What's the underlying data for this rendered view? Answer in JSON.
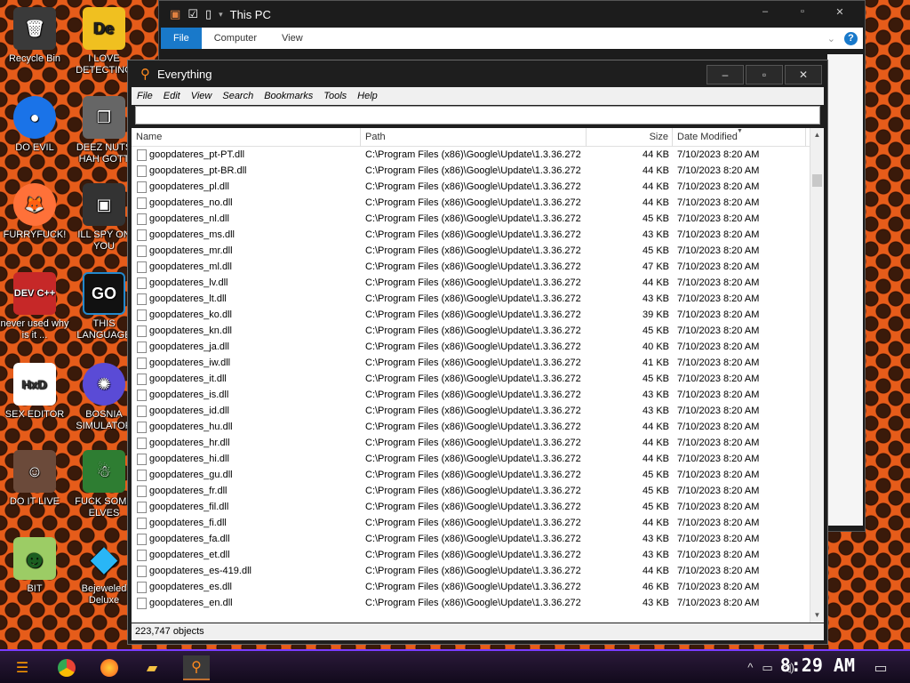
{
  "desktop": {
    "icons": [
      {
        "label": "Recycle Bin",
        "glyph": "🗑"
      },
      {
        "label": "I LOVE DETECTING",
        "glyph": "De"
      },
      {
        "label": "DO EVIL",
        "glyph": "●"
      },
      {
        "label": "DEEZ NUTS HAH GOTT",
        "glyph": "❐"
      },
      {
        "label": "FURRYFUCK!",
        "glyph": "🦊"
      },
      {
        "label": "ILL SPY ON YOU",
        "glyph": "▣"
      },
      {
        "label": "never used why is it ...",
        "glyph": "DEV C++"
      },
      {
        "label": "THIS LANGUAGE",
        "glyph": "GO"
      },
      {
        "label": "SEX EDITOR",
        "glyph": "HxD"
      },
      {
        "label": "BOSNIA SIMULATOR",
        "glyph": "✺"
      },
      {
        "label": "DO IT LIVE",
        "glyph": "☺"
      },
      {
        "label": "FUCK SOME ELVES",
        "glyph": "☃"
      },
      {
        "label": "BIT",
        "glyph": "☻"
      },
      {
        "label": "Bejeweled Deluxe",
        "glyph": "◆"
      }
    ]
  },
  "explorer": {
    "title": "This PC",
    "tabs": [
      "File",
      "Computer",
      "View"
    ],
    "help_icon": "?"
  },
  "everything": {
    "title": "Everything",
    "menu": [
      "File",
      "Edit",
      "View",
      "Search",
      "Bookmarks",
      "Tools",
      "Help"
    ],
    "search_value": "",
    "columns": {
      "name": "Name",
      "path": "Path",
      "size": "Size",
      "date": "Date Modified"
    },
    "rows": [
      {
        "name": "goopdateres_pt-PT.dll",
        "path": "C:\\Program Files (x86)\\Google\\Update\\1.3.36.272",
        "size": "44 KB",
        "date": "7/10/2023 8:20 AM"
      },
      {
        "name": "goopdateres_pt-BR.dll",
        "path": "C:\\Program Files (x86)\\Google\\Update\\1.3.36.272",
        "size": "44 KB",
        "date": "7/10/2023 8:20 AM"
      },
      {
        "name": "goopdateres_pl.dll",
        "path": "C:\\Program Files (x86)\\Google\\Update\\1.3.36.272",
        "size": "44 KB",
        "date": "7/10/2023 8:20 AM"
      },
      {
        "name": "goopdateres_no.dll",
        "path": "C:\\Program Files (x86)\\Google\\Update\\1.3.36.272",
        "size": "44 KB",
        "date": "7/10/2023 8:20 AM"
      },
      {
        "name": "goopdateres_nl.dll",
        "path": "C:\\Program Files (x86)\\Google\\Update\\1.3.36.272",
        "size": "45 KB",
        "date": "7/10/2023 8:20 AM"
      },
      {
        "name": "goopdateres_ms.dll",
        "path": "C:\\Program Files (x86)\\Google\\Update\\1.3.36.272",
        "size": "43 KB",
        "date": "7/10/2023 8:20 AM"
      },
      {
        "name": "goopdateres_mr.dll",
        "path": "C:\\Program Files (x86)\\Google\\Update\\1.3.36.272",
        "size": "45 KB",
        "date": "7/10/2023 8:20 AM"
      },
      {
        "name": "goopdateres_ml.dll",
        "path": "C:\\Program Files (x86)\\Google\\Update\\1.3.36.272",
        "size": "47 KB",
        "date": "7/10/2023 8:20 AM"
      },
      {
        "name": "goopdateres_lv.dll",
        "path": "C:\\Program Files (x86)\\Google\\Update\\1.3.36.272",
        "size": "44 KB",
        "date": "7/10/2023 8:20 AM"
      },
      {
        "name": "goopdateres_lt.dll",
        "path": "C:\\Program Files (x86)\\Google\\Update\\1.3.36.272",
        "size": "43 KB",
        "date": "7/10/2023 8:20 AM"
      },
      {
        "name": "goopdateres_ko.dll",
        "path": "C:\\Program Files (x86)\\Google\\Update\\1.3.36.272",
        "size": "39 KB",
        "date": "7/10/2023 8:20 AM"
      },
      {
        "name": "goopdateres_kn.dll",
        "path": "C:\\Program Files (x86)\\Google\\Update\\1.3.36.272",
        "size": "45 KB",
        "date": "7/10/2023 8:20 AM"
      },
      {
        "name": "goopdateres_ja.dll",
        "path": "C:\\Program Files (x86)\\Google\\Update\\1.3.36.272",
        "size": "40 KB",
        "date": "7/10/2023 8:20 AM"
      },
      {
        "name": "goopdateres_iw.dll",
        "path": "C:\\Program Files (x86)\\Google\\Update\\1.3.36.272",
        "size": "41 KB",
        "date": "7/10/2023 8:20 AM"
      },
      {
        "name": "goopdateres_it.dll",
        "path": "C:\\Program Files (x86)\\Google\\Update\\1.3.36.272",
        "size": "45 KB",
        "date": "7/10/2023 8:20 AM"
      },
      {
        "name": "goopdateres_is.dll",
        "path": "C:\\Program Files (x86)\\Google\\Update\\1.3.36.272",
        "size": "43 KB",
        "date": "7/10/2023 8:20 AM"
      },
      {
        "name": "goopdateres_id.dll",
        "path": "C:\\Program Files (x86)\\Google\\Update\\1.3.36.272",
        "size": "43 KB",
        "date": "7/10/2023 8:20 AM"
      },
      {
        "name": "goopdateres_hu.dll",
        "path": "C:\\Program Files (x86)\\Google\\Update\\1.3.36.272",
        "size": "44 KB",
        "date": "7/10/2023 8:20 AM"
      },
      {
        "name": "goopdateres_hr.dll",
        "path": "C:\\Program Files (x86)\\Google\\Update\\1.3.36.272",
        "size": "44 KB",
        "date": "7/10/2023 8:20 AM"
      },
      {
        "name": "goopdateres_hi.dll",
        "path": "C:\\Program Files (x86)\\Google\\Update\\1.3.36.272",
        "size": "44 KB",
        "date": "7/10/2023 8:20 AM"
      },
      {
        "name": "goopdateres_gu.dll",
        "path": "C:\\Program Files (x86)\\Google\\Update\\1.3.36.272",
        "size": "45 KB",
        "date": "7/10/2023 8:20 AM"
      },
      {
        "name": "goopdateres_fr.dll",
        "path": "C:\\Program Files (x86)\\Google\\Update\\1.3.36.272",
        "size": "45 KB",
        "date": "7/10/2023 8:20 AM"
      },
      {
        "name": "goopdateres_fil.dll",
        "path": "C:\\Program Files (x86)\\Google\\Update\\1.3.36.272",
        "size": "45 KB",
        "date": "7/10/2023 8:20 AM"
      },
      {
        "name": "goopdateres_fi.dll",
        "path": "C:\\Program Files (x86)\\Google\\Update\\1.3.36.272",
        "size": "44 KB",
        "date": "7/10/2023 8:20 AM"
      },
      {
        "name": "goopdateres_fa.dll",
        "path": "C:\\Program Files (x86)\\Google\\Update\\1.3.36.272",
        "size": "43 KB",
        "date": "7/10/2023 8:20 AM"
      },
      {
        "name": "goopdateres_et.dll",
        "path": "C:\\Program Files (x86)\\Google\\Update\\1.3.36.272",
        "size": "43 KB",
        "date": "7/10/2023 8:20 AM"
      },
      {
        "name": "goopdateres_es-419.dll",
        "path": "C:\\Program Files (x86)\\Google\\Update\\1.3.36.272",
        "size": "44 KB",
        "date": "7/10/2023 8:20 AM"
      },
      {
        "name": "goopdateres_es.dll",
        "path": "C:\\Program Files (x86)\\Google\\Update\\1.3.36.272",
        "size": "46 KB",
        "date": "7/10/2023 8:20 AM"
      },
      {
        "name": "goopdateres_en.dll",
        "path": "C:\\Program Files (x86)\\Google\\Update\\1.3.36.272",
        "size": "43 KB",
        "date": "7/10/2023 8:20 AM"
      }
    ],
    "status": "223,747 objects"
  },
  "taskbar": {
    "clock": "8:29 AM",
    "apps": [
      "start-icon",
      "chrome-icon",
      "firefox-icon",
      "file-explorer-icon",
      "everything-search-icon"
    ]
  },
  "colors": {
    "desktop_orange": "#e65c1a",
    "taskbar_accent": "#7a3cff",
    "ribbon_file_blue": "#1979ca"
  }
}
